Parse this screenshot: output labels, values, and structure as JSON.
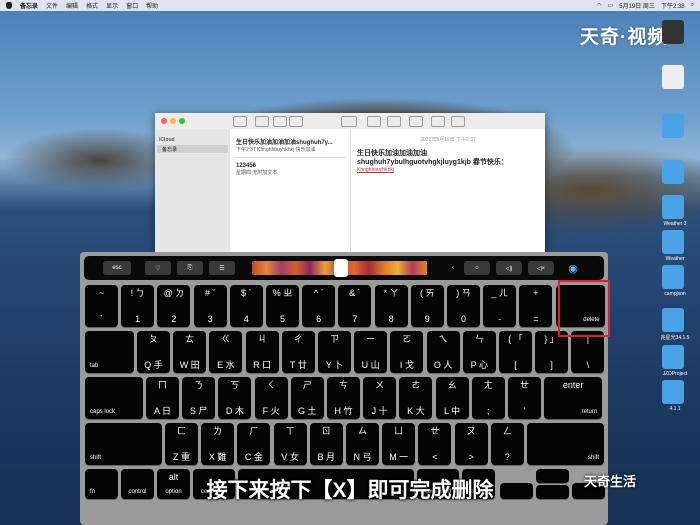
{
  "menubar": {
    "items": [
      "备忘录",
      "文件",
      "编辑",
      "格式",
      "显示",
      "窗口",
      "帮助"
    ],
    "clock": "下午2:38",
    "status_date": "5月19日 周三"
  },
  "watermark_top": "天奇·视频",
  "watermark_bottom": "天奇生活",
  "desktop_icons": [
    {
      "label": "",
      "color": "#333333"
    },
    {
      "label": "",
      "color": "#eeeeee"
    },
    {
      "label": "",
      "color": "#4aa3e6"
    },
    {
      "label": "",
      "color": "#4aa3e6"
    },
    {
      "label": "Weather 3",
      "color": "#4aa3e6"
    },
    {
      "label": "Weather",
      "color": "#4aa3e6"
    },
    {
      "label": "campjson",
      "color": "#4aa3e6"
    },
    {
      "label": "兆星光34.1.5",
      "color": "#4aa3e6"
    },
    {
      "label": "JZDProject",
      "color": "#4aa3e6"
    },
    {
      "label": "4.1.1",
      "color": "#4aa3e6"
    }
  ],
  "notes_window": {
    "sidebar_header": "iCloud",
    "sidebar_item": "备忘录",
    "notes": [
      {
        "title": "生日快乐加油加油加油shughuh7y...",
        "time": "下午2:37",
        "preview": "Khnghhbuyhkhkj 快乐加油"
      },
      {
        "title": "123456",
        "time": "星期四",
        "preview": "无附加文本"
      }
    ],
    "detail_date": "2022年5月19日 下午2:37",
    "detail_text_1": "生日快乐加油加油加油",
    "detail_text_2": "shughuh7ybulhguotvhgkjluyg1kjb 春节快乐：",
    "detail_text_3": "Khnghhbuyhkhkj"
  },
  "touchbar": {
    "esc": "esc",
    "buttons": [
      "♡",
      "⎘",
      "☰",
      "‹",
      "☼",
      "◁)",
      "◁×",
      "◉"
    ]
  },
  "keyboard": {
    "row1": [
      {
        "t": "~",
        "b": "`"
      },
      {
        "t": "! ㄅ",
        "b": "1"
      },
      {
        "t": "@ ㄉ",
        "b": "2"
      },
      {
        "t": "# ˇ",
        "b": "3"
      },
      {
        "t": "$ ˋ",
        "b": "4"
      },
      {
        "t": "% ㄓ",
        "b": "5"
      },
      {
        "t": "^ ˊ",
        "b": "6"
      },
      {
        "t": "& ˙",
        "b": "7"
      },
      {
        "t": "* ㄚ",
        "b": "8"
      },
      {
        "t": "( ㄞ",
        "b": "9"
      },
      {
        "t": ") ㄢ",
        "b": "0"
      },
      {
        "t": "_ ㄦ",
        "b": "-"
      },
      {
        "t": "+",
        "b": "="
      }
    ],
    "delete": "delete",
    "tab": "tab",
    "row2": [
      {
        "t": "ㄆ",
        "b": "Q 手"
      },
      {
        "t": "ㄊ",
        "b": "W 田"
      },
      {
        "t": "ㄍ",
        "b": "E 水"
      },
      {
        "t": "ㄐ",
        "b": "R 口"
      },
      {
        "t": "ㄔ",
        "b": "T 廿"
      },
      {
        "t": "ㄗ",
        "b": "Y 卜"
      },
      {
        "t": "ㄧ",
        "b": "U 山"
      },
      {
        "t": "ㄛ",
        "b": "I 戈"
      },
      {
        "t": "ㄟ",
        "b": "O 人"
      },
      {
        "t": "ㄣ",
        "b": "P 心"
      },
      {
        "t": "{ 「",
        "b": "["
      },
      {
        "t": "} 」",
        "b": "]"
      },
      {
        "t": "|",
        "b": "\\"
      }
    ],
    "caps": "caps lock",
    "enter": "enter",
    "return": "return",
    "row3": [
      {
        "t": "ㄇ",
        "b": "A 日"
      },
      {
        "t": "ㄋ",
        "b": "S 尸"
      },
      {
        "t": "ㄎ",
        "b": "D 木"
      },
      {
        "t": "ㄑ",
        "b": "F 火"
      },
      {
        "t": "ㄕ",
        "b": "G 土"
      },
      {
        "t": "ㄘ",
        "b": "H 竹"
      },
      {
        "t": "ㄨ",
        "b": "J 十"
      },
      {
        "t": "ㄜ",
        "b": "K 大"
      },
      {
        "t": "ㄠ",
        "b": "L 中"
      },
      {
        "t": "ㄤ",
        "b": ";"
      },
      {
        "t": "ㄝ",
        "b": "'"
      }
    ],
    "shift": "shift",
    "row4": [
      {
        "t": "ㄈ",
        "b": "Z 重"
      },
      {
        "t": "ㄌ",
        "b": "X 難"
      },
      {
        "t": "ㄏ",
        "b": "C 金"
      },
      {
        "t": "ㄒ",
        "b": "V 女"
      },
      {
        "t": "ㄖ",
        "b": "B 月"
      },
      {
        "t": "ㄙ",
        "b": "N 弓"
      },
      {
        "t": "ㄩ",
        "b": "M 一"
      },
      {
        "t": "ㄝ",
        "b": "<"
      },
      {
        "t": "ㄡ",
        "b": ">"
      },
      {
        "t": "ㄥ",
        "b": "?"
      }
    ],
    "fn": "fn",
    "control": "control",
    "option": "option",
    "command": "command",
    "alt": "alt"
  },
  "caption": "接下来按下【X】即可完成删除"
}
